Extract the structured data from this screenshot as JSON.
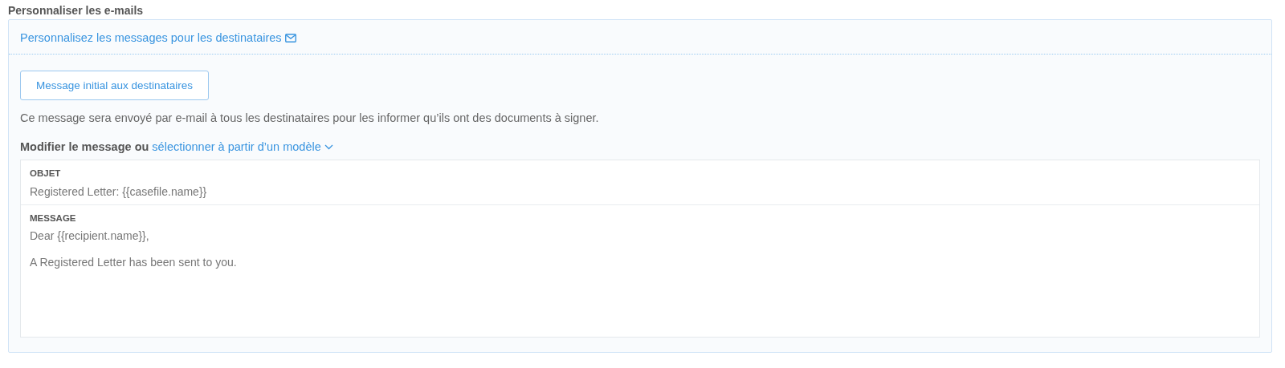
{
  "section_title": "Personnaliser les e-mails",
  "panel": {
    "header_link": "Personnalisez les messages pour les destinataires",
    "tabs": [
      {
        "label": "Message initial aux destinataires",
        "selected": true
      }
    ],
    "description": "Ce message sera envoyé par e-mail à tous les destinataires pour les informer qu’ils ont des documents à signer.",
    "edit_prompt": "Modifier le message ou",
    "template_link": "sélectionner à partir d’un modèle",
    "subject": {
      "label": "OBJET",
      "value": "Registered Letter: {{casefile.name}}"
    },
    "message": {
      "label": "MESSAGE",
      "paragraphs": [
        "Dear {{recipient.name}},",
        "A Registered Letter has been sent to you."
      ]
    }
  }
}
